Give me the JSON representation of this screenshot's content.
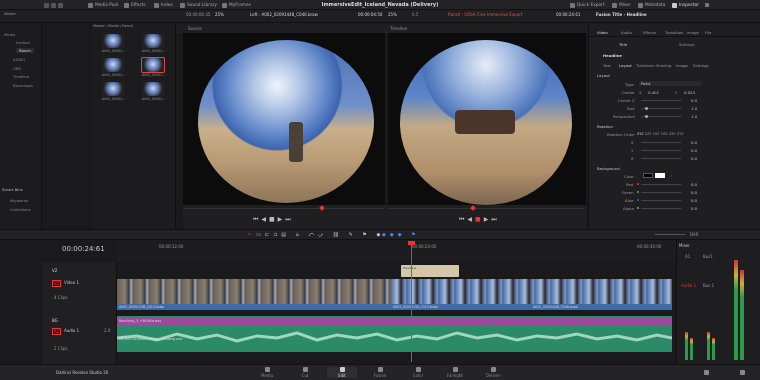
{
  "topbar": {
    "tabs": [
      "Media Pool",
      "Effects",
      "Index",
      "Sound Library",
      "MyFrames"
    ],
    "project_title": "ImmersiveEdit_Iceland_Nevada (Delivery)",
    "right_items": [
      "Quick Export",
      "Mixer",
      "Metadata",
      "Inspector"
    ]
  },
  "viewer_row": {
    "zoom_left": "25%",
    "zoom_center": "25%",
    "opacity": "0.5",
    "tc_left": "00:00:06:35",
    "clip_left": "Left - A002_02091448_C046.braw",
    "tc_left_dur": "00:00:04:50",
    "tc_right": "00:00:55:58",
    "timeline_name": "Ranch - URSA Cine Immersive Export",
    "tc_right_end": "00:00:24:61",
    "inspector_title": "Fusion Title - Headline",
    "source_label": "Source",
    "timeline_label": "Timeline"
  },
  "left_bar": {
    "items": [
      "Master",
      "Media",
      "Iceland",
      "Ranch",
      "AUDIO",
      "OBS",
      "Timeline",
      "Backdrops"
    ],
    "smart_bins": "Smart Bins",
    "keywords": "Keywords",
    "collections": "Collections"
  },
  "media_pool": {
    "path": "Master / Media / Ranch",
    "clips": [
      "A002_02091...",
      "A002_02091...",
      "A002_02091...",
      "A002_02091...",
      "A002_02091...",
      "A002_02091..."
    ]
  },
  "inspector": {
    "tabs": [
      "Video",
      "Audio",
      "Effects",
      "Transition",
      "Image",
      "File"
    ],
    "subtabs": [
      "Title",
      "Settings"
    ],
    "node": "Headline",
    "section_tabs": [
      "Text",
      "Layout",
      "Transform",
      "Shading",
      "Image",
      "Settings"
    ],
    "layout": {
      "label": "Layout",
      "type_label": "Type",
      "type_value": "Point",
      "center_label": "Center",
      "center_x_label": "X",
      "center_x": "0.401",
      "center_y_label": "Y",
      "center_y": "0.524",
      "center_z_label": "Center Z",
      "center_z": "0.0",
      "size_label": "Size",
      "size": "1.0",
      "perspective_label": "Perspective",
      "perspective": "1.0"
    },
    "rotation": {
      "label": "Rotation",
      "order_label": "Rotation Order",
      "orders": [
        "XYZ",
        "XZY",
        "YXZ",
        "YZX",
        "ZXY",
        "ZYX"
      ],
      "axis_labels": [
        "X",
        "Y",
        "Z"
      ],
      "values": [
        "0.0",
        "0.0",
        "0.0"
      ]
    },
    "background": {
      "label": "Background",
      "color_label": "Color",
      "channels": [
        {
          "label": "Red",
          "value": "0.0",
          "color": "#d33"
        },
        {
          "label": "Green",
          "value": "0.0",
          "color": "#3c3"
        },
        {
          "label": "Blue",
          "value": "0.0",
          "color": "#36d"
        },
        {
          "label": "Alpha",
          "value": "0.0",
          "color": "#999"
        }
      ]
    }
  },
  "timeline": {
    "timecode": "00:00:24:61",
    "ruler": [
      "00:00:12:00",
      "00:00:24:00",
      "00:00:36:00"
    ],
    "tracks": [
      {
        "id": "V2",
        "name": "",
        "clips": ""
      },
      {
        "id": "V1",
        "name": "Video 1",
        "clips": "4 Clips"
      },
      {
        "id": "BG",
        "name": "",
        "clips": ""
      },
      {
        "id": "A1",
        "name": "Audio 1",
        "clips": "2 Clips",
        "level": "2.0"
      }
    ],
    "clip_names": [
      "A002_02091338_C013.braw",
      "A002_02091150_C013.braw",
      "A002_02091448_C046.braw"
    ],
    "title_clip": "Headline",
    "audio_clips": [
      "Ranchtrip_3_+48.8Kw.wav",
      "05_Sun Elevation - Victor Lundberg.wav"
    ],
    "zoom_percent": "DAR",
    "mixer": {
      "title": "Mixer",
      "ch1": "A1",
      "ch2": "Bus1",
      "ch1_label": "Audio 1",
      "ch2_label": "Bus 1"
    }
  },
  "bottombar": {
    "app": "DaVinci Resolve Studio 20",
    "pages": [
      "Media",
      "Cut",
      "Edit",
      "Fusion",
      "Color",
      "Fairlight",
      "Deliver"
    ],
    "active_page": "Edit"
  },
  "colors": {
    "accent": "#e33",
    "audio": "#2b8a68",
    "title_clip": "#d2c7a8"
  }
}
